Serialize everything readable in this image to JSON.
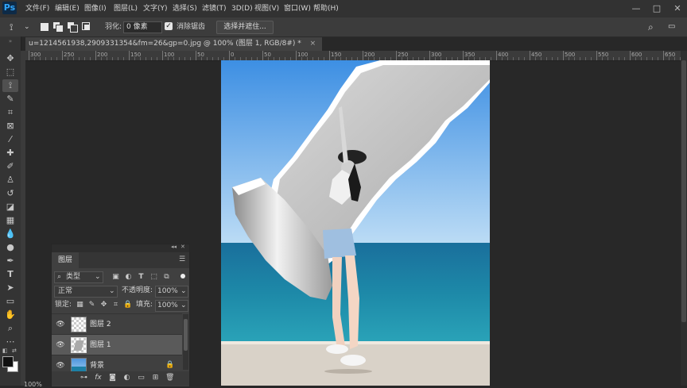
{
  "app": {
    "logo": "Ps"
  },
  "menu": [
    "文件(F)",
    "编辑(E)",
    "图像(I)",
    "图层(L)",
    "文字(Y)",
    "选择(S)",
    "滤镜(T)",
    "3D(D)",
    "视图(V)",
    "窗口(W)",
    "帮助(H)"
  ],
  "window_controls": {
    "minimize": "—",
    "maximize": "□",
    "close": "✕"
  },
  "options": {
    "feather_label": "羽化:",
    "feather_value": "0 像素",
    "antialias_label": "消除锯齿",
    "antialias_checked": true,
    "select_mask_button": "选择并遮住..."
  },
  "document": {
    "tab_title": "u=1214561938,2909331354&fm=26&gp=0.jpg @ 100% (图层 1, RGB/8#) *",
    "close_label": "×"
  },
  "ruler": {
    "labels": [
      "300",
      "250",
      "200",
      "150",
      "100",
      "50",
      "0",
      "50",
      "100",
      "150",
      "200",
      "250",
      "300",
      "350",
      "400",
      "450",
      "500",
      "550",
      "600",
      "650"
    ]
  },
  "layers_panel": {
    "title": "图层",
    "filter_label": "类型",
    "blend_mode": "正常",
    "opacity_label": "不透明度:",
    "opacity_value": "100%",
    "lock_label": "锁定:",
    "fill_label": "填充:",
    "fill_value": "100%",
    "layers": [
      {
        "name": "图层 2",
        "visible": true,
        "selected": false,
        "kind": "transparent"
      },
      {
        "name": "图层 1",
        "visible": true,
        "selected": true,
        "kind": "paper"
      },
      {
        "name": "背景",
        "visible": true,
        "selected": false,
        "kind": "photo",
        "locked": true
      }
    ],
    "footer_icons": [
      "link-icon",
      "fx-icon",
      "mask-icon",
      "adjustment-icon",
      "group-icon",
      "new-layer-icon",
      "delete-icon"
    ],
    "footer_fx": "fx"
  },
  "status": {
    "zoom": "100%"
  },
  "colors": {
    "sky": "#5aa0e0",
    "sea": "#1f7fa3",
    "paper": "#bdbdbd",
    "accent": "#31a8ff"
  }
}
